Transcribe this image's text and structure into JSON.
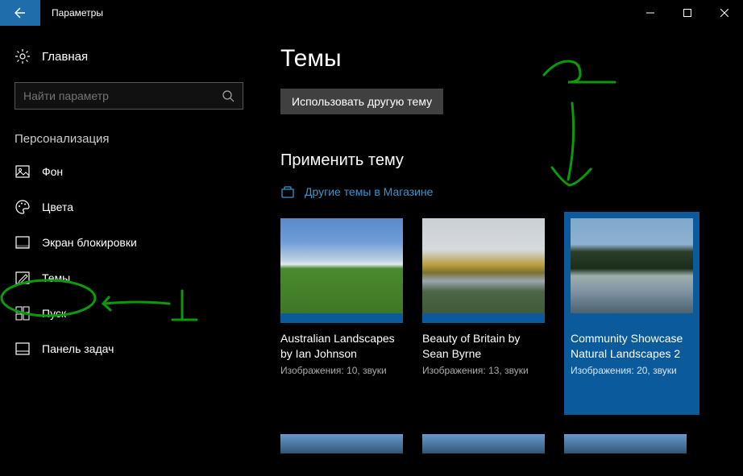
{
  "titlebar": {
    "title": "Параметры"
  },
  "sidebar": {
    "home": "Главная",
    "search_placeholder": "Найти параметр",
    "section": "Персонализация",
    "items": [
      {
        "label": "Фон"
      },
      {
        "label": "Цвета"
      },
      {
        "label": "Экран блокировки"
      },
      {
        "label": "Темы"
      },
      {
        "label": "Пуск"
      },
      {
        "label": "Панель задач"
      }
    ]
  },
  "main": {
    "title": "Темы",
    "use_different": "Использовать другую тему",
    "apply_title": "Применить тему",
    "store_link": "Другие темы в Магазине",
    "themes": [
      {
        "name": "Australian Landscapes by Ian Johnson",
        "meta": "Изображения: 10, звуки"
      },
      {
        "name": "Beauty of Britain by Sean Byrne",
        "meta": "Изображения: 13, звуки"
      },
      {
        "name": "Community Showcase Natural Landscapes 2",
        "meta": "Изображения: 20, звуки"
      }
    ]
  },
  "annotations": {
    "one": "1",
    "two": "2"
  }
}
